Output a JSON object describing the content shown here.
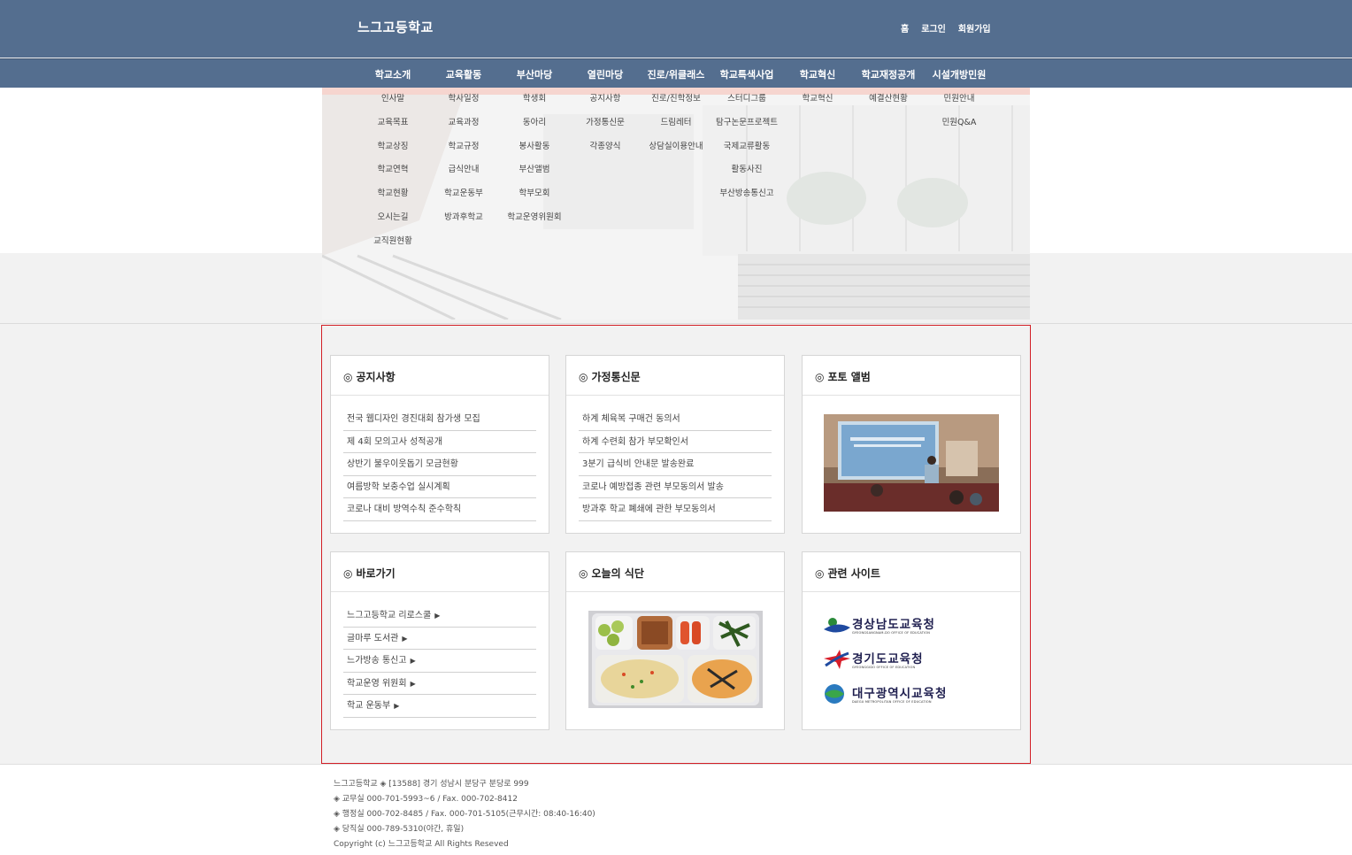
{
  "header": {
    "title": "느그고등학교",
    "util_links": [
      "홈",
      "로그인",
      "회원가입"
    ]
  },
  "nav": {
    "menus": [
      {
        "label": "학교소개",
        "items": [
          "인사말",
          "교육목표",
          "학교상징",
          "학교연혁",
          "학교현황",
          "오시는길",
          "교직원현황"
        ]
      },
      {
        "label": "교육활동",
        "items": [
          "학사일정",
          "교육과정",
          "학교규정",
          "급식안내",
          "학교운동부",
          "방과후학교"
        ]
      },
      {
        "label": "부산마당",
        "items": [
          "학생회",
          "동아리",
          "봉사활동",
          "부산앨범",
          "학부모회",
          "학교운영위원회"
        ]
      },
      {
        "label": "열린마당",
        "items": [
          "공지사항",
          "가정통신문",
          "각종양식"
        ]
      },
      {
        "label": "진로/위클래스",
        "items": [
          "진로/진학정보",
          "드림레터",
          "상담실이용안내"
        ]
      },
      {
        "label": "학교특색사업",
        "items": [
          "스터디그룹",
          "탐구논문프로젝트",
          "국제교류활동",
          "활동사진",
          "부산방송통신고"
        ]
      },
      {
        "label": "학교혁신",
        "items": [
          "학교혁신"
        ]
      },
      {
        "label": "학교재정공개",
        "items": [
          "예결산현황"
        ]
      },
      {
        "label": "시설개방민원",
        "items": [
          "민원안내",
          "민원Q&A"
        ]
      }
    ]
  },
  "boxes": {
    "notice": {
      "title": "공지사항",
      "items": [
        "전국 웹디자인 경진대회 참가생 모집",
        "제 4회 모의고사 성적공개",
        "상반기 불우이웃돕기 모금현황",
        "여름방학 보충수업 실시계획",
        "코로나 대비 방역수칙 준수학칙"
      ]
    },
    "letter": {
      "title": "가정통신문",
      "items": [
        "하계 체육복 구매건 동의서",
        "하계 수련회 참가 부모확인서",
        "3분기 급식비 안내문 발송완료",
        "코로나 예방접종 관련 부모동의서 발송",
        "방과후 학교 폐쇄에 관한 부모동의서"
      ]
    },
    "album": {
      "title": "포토 앨범"
    },
    "shortcut": {
      "title": "바로가기",
      "items": [
        "느그고등학교 리로스쿨",
        "글마루 도서관",
        "느가방송 통신고",
        "학교운영 위원회",
        "학교 운동부"
      ],
      "arrow": "▶"
    },
    "meal": {
      "title": "오늘의 식단"
    },
    "sites": {
      "title": "관련 사이트",
      "logos": [
        {
          "name": "경상남도교육청",
          "sub": "GYEONGSANGNAM-DO OFFICE OF EDUCATION"
        },
        {
          "name": "경기도교육청",
          "sub": "GYEONGGIDO OFFICE OF EDUCATION"
        },
        {
          "name": "대구광역시교육청",
          "sub": "DAEGU METROPOLITAN OFFICE OF EDUCATION"
        }
      ]
    }
  },
  "box_marker": "◎",
  "footer": {
    "lines": [
      "느그고등학교 ◈ [13588] 경기 성남시 분당구 분당로 999",
      "◈ 교무실 000-701-5993~6 / Fax. 000-702-8412",
      "◈ 행정실 000-702-8485 / Fax. 000-701-5105(근무시간: 08:40-16:40)",
      "◈ 당직실 000-789-5310(야간, 휴일)",
      "Copyright (c) 느그고등학교 All Rights Reseved"
    ]
  },
  "colors": {
    "header_bg": "#546e8f",
    "accent_border": "#d21f26"
  }
}
